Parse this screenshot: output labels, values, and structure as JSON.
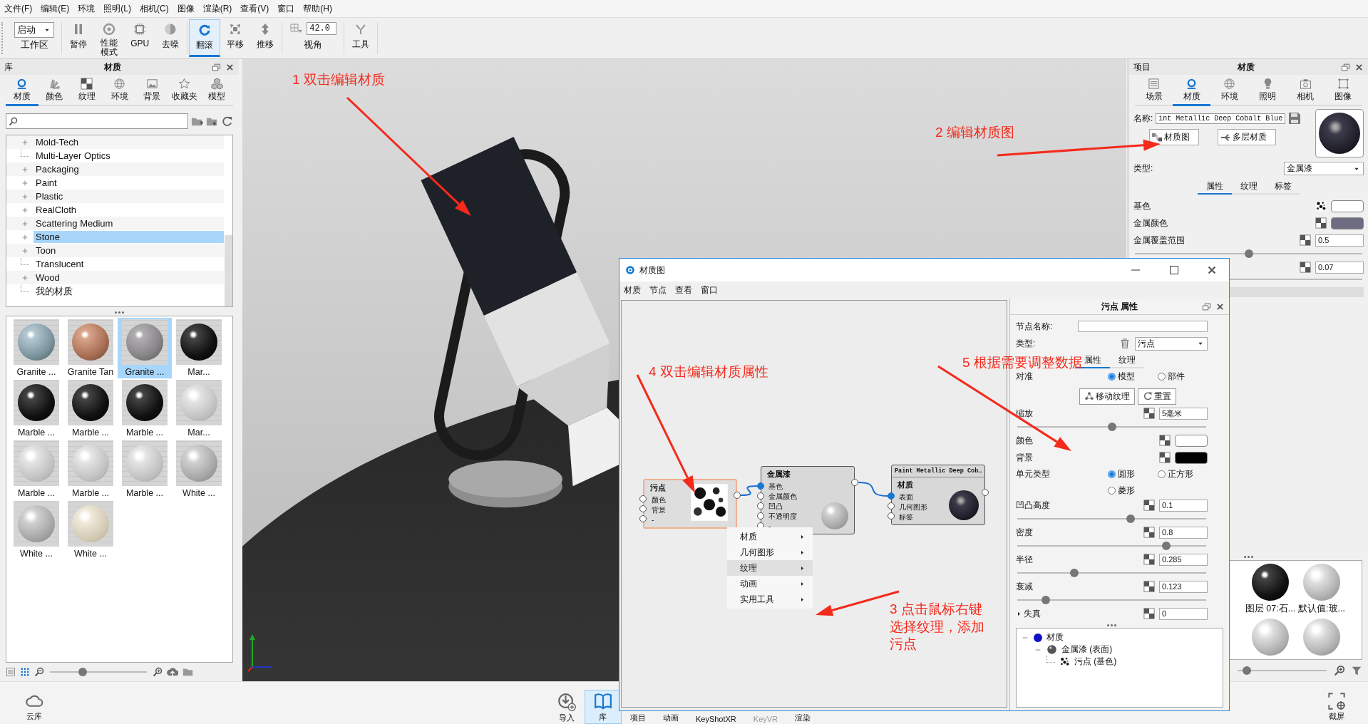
{
  "menu_bar": [
    "文件(F)",
    "编辑(E)",
    "环境",
    "照明(L)",
    "相机(C)",
    "图像",
    "渲染(R)",
    "查看(V)",
    "窗口",
    "帮助(H)"
  ],
  "toolbar": {
    "workspace": {
      "value": "启动",
      "label": "工作区"
    },
    "tools": [
      {
        "kind": "pause",
        "label": "暂停",
        "selected": false
      },
      {
        "kind": "performance",
        "label": "性能模式",
        "selected": false
      },
      {
        "kind": "gpu",
        "label": "GPU",
        "selected": false
      },
      {
        "kind": "denoise",
        "label": "去噪",
        "selected": false
      },
      {
        "kind": "tumble",
        "label": "翻滚",
        "selected": true
      },
      {
        "kind": "pan",
        "label": "平移",
        "selected": false
      },
      {
        "kind": "dolly",
        "label": "推移",
        "selected": false
      }
    ],
    "field_of_view": {
      "value": "42.0",
      "label": "视角"
    },
    "tools_menu": {
      "label": "工具"
    }
  },
  "library_panel": {
    "title": "库",
    "heading": "材质",
    "tabs": [
      {
        "kind": "material",
        "label": "材质",
        "selected": true
      },
      {
        "kind": "color",
        "label": "颜色",
        "selected": false
      },
      {
        "kind": "texture",
        "label": "纹理",
        "selected": false
      },
      {
        "kind": "environment",
        "label": "环境",
        "selected": false
      },
      {
        "kind": "background",
        "label": "背景",
        "selected": false
      },
      {
        "kind": "favorites",
        "label": "收藏夹",
        "selected": false
      },
      {
        "kind": "model",
        "label": "模型",
        "selected": false
      }
    ],
    "tree": [
      {
        "label": "Mold-Tech",
        "expandable": true,
        "selected": false
      },
      {
        "label": "Multi-Layer Optics",
        "expandable": false,
        "selected": false
      },
      {
        "label": "Packaging",
        "expandable": true,
        "selected": false
      },
      {
        "label": "Paint",
        "expandable": true,
        "selected": false
      },
      {
        "label": "Plastic",
        "expandable": true,
        "selected": false
      },
      {
        "label": "RealCloth",
        "expandable": true,
        "selected": false
      },
      {
        "label": "Scattering Medium",
        "expandable": true,
        "selected": false
      },
      {
        "label": "Stone",
        "expandable": true,
        "selected": true
      },
      {
        "label": "Toon",
        "expandable": true,
        "selected": false
      },
      {
        "label": "Translucent",
        "expandable": false,
        "selected": false
      },
      {
        "label": "Wood",
        "expandable": true,
        "selected": false
      },
      {
        "label": "我的材质",
        "expandable": false,
        "selected": false
      }
    ],
    "thumbnails": [
      {
        "label": "Granite ...",
        "kind": "bluegranite",
        "selected": false
      },
      {
        "label": "Granite Tan",
        "kind": "tangranite",
        "selected": false
      },
      {
        "label": "Granite ...",
        "kind": "greygranite",
        "selected": true
      },
      {
        "label": "Mar...",
        "kind": "black",
        "selected": false
      },
      {
        "label": "Marble ...",
        "kind": "black",
        "selected": false
      },
      {
        "label": "Marble ...",
        "kind": "black",
        "selected": false
      },
      {
        "label": "Marble ...",
        "kind": "black",
        "selected": false
      },
      {
        "label": "Mar...",
        "kind": "white",
        "selected": false
      },
      {
        "label": "Marble ...",
        "kind": "white",
        "selected": false
      },
      {
        "label": "Marble ...",
        "kind": "white",
        "selected": false
      },
      {
        "label": "Marble ...",
        "kind": "white",
        "selected": false
      },
      {
        "label": "White ...",
        "kind": "grey",
        "selected": false
      },
      {
        "label": "White ...",
        "kind": "grey",
        "selected": false
      },
      {
        "label": "White ...",
        "kind": "cream",
        "selected": false
      }
    ],
    "thumbnail_size": {
      "level": 0.34
    }
  },
  "project_panel": {
    "title": "项目",
    "heading": "材质",
    "tabs": [
      {
        "kind": "scene",
        "label": "场景",
        "selected": false
      },
      {
        "kind": "material",
        "label": "材质",
        "selected": true
      },
      {
        "kind": "environment",
        "label": "环境",
        "selected": false
      },
      {
        "kind": "lighting",
        "label": "照明",
        "selected": false
      },
      {
        "kind": "camera",
        "label": "相机",
        "selected": false
      },
      {
        "kind": "image",
        "label": "图像",
        "selected": false
      }
    ],
    "name_label": "名称:",
    "name_value": "int Metallic Deep Cobalt Blue",
    "buttons": [
      {
        "kind": "graph",
        "label": "材质图"
      },
      {
        "kind": "layers",
        "label": "多层材质"
      }
    ],
    "type_label": "类型:",
    "type_value": "金属漆",
    "subtabs": [
      {
        "label": "属性",
        "selected": true
      },
      {
        "label": "纹理",
        "selected": false
      },
      {
        "label": "标签",
        "selected": false
      }
    ],
    "properties": [
      {
        "kind": "color",
        "label": "基色",
        "texture_linked": true,
        "color": "#ffffff"
      },
      {
        "kind": "color",
        "label": "金属颜色",
        "texture_linked": false,
        "color": "#6d6c82"
      },
      {
        "kind": "slider",
        "label": "金属覆盖范围",
        "value": "0.5",
        "level": 0.5
      },
      {
        "kind": "number",
        "value": "0.07"
      }
    ],
    "library_thumbnails": [
      {
        "label": "图层 07:石...",
        "kind": "black"
      },
      {
        "label": "默认值:玻...",
        "kind": "silver"
      },
      {
        "kind": "silver"
      },
      {
        "kind": "silver"
      }
    ],
    "thumbnail_size": {
      "level": 0.1
    }
  },
  "annotations": [
    {
      "lines": [
        "1 双击编辑材质"
      ]
    },
    {
      "lines": [
        "2 编辑材质图"
      ]
    },
    {
      "lines": [
        "3 点击鼠标右键",
        "选择纹理，添加",
        "污点"
      ]
    },
    {
      "lines": [
        "4 双击编辑材质属性"
      ]
    },
    {
      "lines": [
        "5 根据需要调整数据"
      ]
    }
  ],
  "material_graph": {
    "title": "材质图",
    "menu": [
      "材质",
      "节点",
      "查看",
      "窗口"
    ],
    "nodes": [
      {
        "kind": "texture",
        "title": "污点",
        "selected": true,
        "inputs": [
          {
            "label": "颜色",
            "connected": false
          },
          {
            "label": "背景",
            "connected": false
          },
          {
            "label": "-",
            "connected": false
          }
        ]
      },
      {
        "kind": "paint",
        "title": "金属漆",
        "selected": false,
        "inputs": [
          {
            "label": "基色",
            "connected": true
          },
          {
            "label": "金属颜色",
            "connected": false
          },
          {
            "label": "凹凸",
            "connected": false
          },
          {
            "label": "不透明度",
            "connected": false
          },
          {
            "label": "-",
            "connected": false
          }
        ]
      },
      {
        "kind": "material",
        "subtitle": "Paint Metallic Deep Cob…",
        "title": "材质",
        "selected": false,
        "inputs": [
          {
            "label": "表面",
            "connected": true
          },
          {
            "label": "几何图形",
            "connected": false
          },
          {
            "label": "标签",
            "connected": false
          }
        ]
      }
    ],
    "context_menu": [
      {
        "label": "材质",
        "selected": false
      },
      {
        "label": "几何图形",
        "selected": false
      },
      {
        "label": "纹理",
        "selected": true
      },
      {
        "label": "动画",
        "selected": false
      },
      {
        "label": "实用工具",
        "selected": false
      }
    ],
    "properties": {
      "title": "污点  属性",
      "node_name_label": "节点名称:",
      "type_label": "类型:",
      "type_value": "污点",
      "tabs": [
        {
          "label": "属性",
          "selected": true
        },
        {
          "label": "纹理",
          "selected": false
        }
      ],
      "rows": [
        {
          "kind": "radio",
          "label": "对准",
          "options": [
            {
              "label": "模型",
              "selected": true
            },
            {
              "label": "部件",
              "selected": false
            }
          ]
        },
        {
          "kind": "buttons",
          "buttons": [
            {
              "kind": "move",
              "label": "移动纹理"
            },
            {
              "kind": "reset",
              "label": "重置"
            }
          ]
        },
        {
          "kind": "slider",
          "label": "缩放",
          "value": "5毫米",
          "level": 0.5
        },
        {
          "kind": "color",
          "label": "颜色",
          "color": "#ffffff"
        },
        {
          "kind": "color",
          "label": "背景",
          "color": "#000000"
        },
        {
          "kind": "radio",
          "label": "单元类型",
          "options": [
            {
              "label": "圆形",
              "selected": true
            },
            {
              "label": "正方形",
              "selected": false
            },
            {
              "label": "菱形",
              "selected": false
            }
          ]
        },
        {
          "kind": "slider",
          "label": "凹凸高度",
          "value": "0.1",
          "level": 0.6
        },
        {
          "kind": "slider",
          "label": "密度",
          "value": "0.8",
          "level": 0.79
        },
        {
          "kind": "slider",
          "label": "半径",
          "value": "0.285",
          "level": 0.3
        },
        {
          "kind": "slider",
          "label": "衰减",
          "value": "0.123",
          "level": 0.15
        },
        {
          "kind": "group",
          "label": "失真",
          "expanded": false,
          "value": "0"
        }
      ],
      "tree": [
        {
          "label": "材质",
          "kind": "material",
          "expanded": true,
          "children": [
            {
              "label": "金属漆 (表面)",
              "kind": "paint",
              "expanded": true,
              "children": [
                {
                  "label": "污点 (基色)",
                  "kind": "texture"
                }
              ]
            }
          ]
        }
      ]
    }
  },
  "bottom_bar": {
    "left": {
      "kind": "cloud",
      "label": "云库"
    },
    "items": [
      {
        "kind": "import",
        "label": "导入",
        "selected": false,
        "disabled": false
      },
      {
        "kind": "book",
        "label": "库",
        "selected": true,
        "disabled": false
      },
      {
        "kind": "tab",
        "label": "项目",
        "selected": false,
        "disabled": false
      },
      {
        "kind": "tab",
        "label": "动画",
        "selected": false,
        "disabled": false
      },
      {
        "kind": "tab",
        "label": "KeyShotXR",
        "selected": false,
        "disabled": false
      },
      {
        "kind": "tab",
        "label": "KeyVR",
        "selected": false,
        "disabled": true
      },
      {
        "kind": "tab",
        "label": "渲染",
        "selected": false,
        "disabled": false
      }
    ],
    "right": {
      "kind": "screenshot",
      "label": "截屏"
    }
  }
}
